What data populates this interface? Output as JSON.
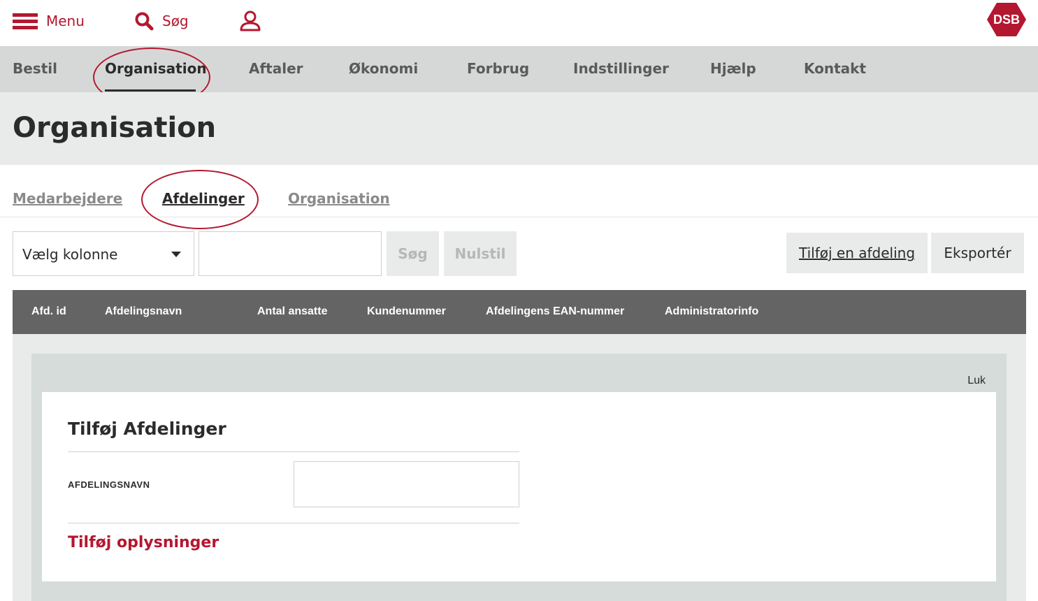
{
  "topbar": {
    "menu_label": "Menu",
    "search_label": "Søg",
    "logo_text": "DSB",
    "menu_icon": "hamburger-icon",
    "search_icon": "search-icon",
    "user_icon": "user-icon"
  },
  "nav": {
    "items": [
      {
        "label": "Bestil"
      },
      {
        "label": "Organisation",
        "active": true
      },
      {
        "label": "Aftaler"
      },
      {
        "label": "Økonomi"
      },
      {
        "label": "Forbrug"
      },
      {
        "label": "Indstillinger"
      },
      {
        "label": "Hjælp"
      },
      {
        "label": "Kontakt"
      }
    ]
  },
  "page": {
    "title": "Organisation"
  },
  "subtabs": {
    "items": [
      {
        "label": "Medarbejdere"
      },
      {
        "label": "Afdelinger",
        "active": true
      },
      {
        "label": "Organisation"
      }
    ]
  },
  "toolbar": {
    "column_select_value": "Vælg kolonne",
    "search_value": "",
    "search_button": "Søg",
    "reset_button": "Nulstil",
    "add_button": "Tilføj en afdeling",
    "export_button": "Eksportér"
  },
  "table": {
    "columns": [
      "Afd. id",
      "Afdelingsnavn",
      "Antal ansatte",
      "Kundenummer",
      "Afdelingens EAN-nummer",
      "Administratorinfo"
    ]
  },
  "panel": {
    "close_label": "Luk",
    "title": "Tilføj Afdelinger",
    "field_label": "AFDELINGSNAVN",
    "field_value": "",
    "add_info_label": "Tilføj oplysninger"
  },
  "colors": {
    "brand_red": "#b41730",
    "nav_bg": "#d6d8d8",
    "table_header_bg": "#646464",
    "panel_bg": "#d5dcd9"
  }
}
